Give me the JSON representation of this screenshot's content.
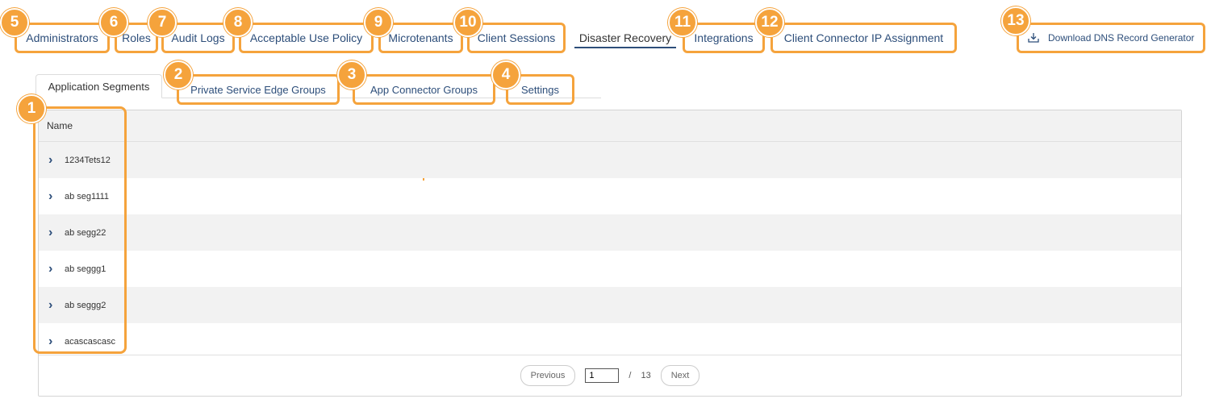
{
  "nav": {
    "administrators": "Administrators",
    "roles": "Roles",
    "audit_logs": "Audit Logs",
    "acceptable_use_policy": "Acceptable Use Policy",
    "microtenants": "Microtenants",
    "client_sessions": "Client Sessions",
    "disaster_recovery": "Disaster Recovery",
    "integrations": "Integrations",
    "client_connector_ip": "Client Connector IP Assignment",
    "download_dns": "Download DNS Record Generator"
  },
  "tabs": {
    "application_segments": "Application Segments",
    "private_service_edge_groups": "Private Service Edge Groups",
    "app_connector_groups": "App Connector Groups",
    "settings": "Settings"
  },
  "table": {
    "header_name": "Name",
    "rows": [
      "1234Tets12",
      "ab seg1111",
      "ab segg22",
      "ab seggg1",
      "ab seggg2",
      "acascascasc"
    ]
  },
  "pagination": {
    "previous": "Previous",
    "current_page": "1",
    "separator": "/",
    "total_pages": "13",
    "next": "Next"
  },
  "badges": {
    "b1": "1",
    "b2": "2",
    "b3": "3",
    "b4": "4",
    "b5": "5",
    "b6": "6",
    "b7": "7",
    "b8": "8",
    "b9": "9",
    "b10": "10",
    "b11": "11",
    "b12": "12",
    "b13": "13"
  },
  "colors": {
    "annotation_orange": "#f5a33c",
    "link_blue": "#2d4e7a",
    "stripe_gray": "#f2f2f2"
  },
  "icons": {
    "download": "download-icon",
    "row_expand": "chevron-right-icon"
  }
}
